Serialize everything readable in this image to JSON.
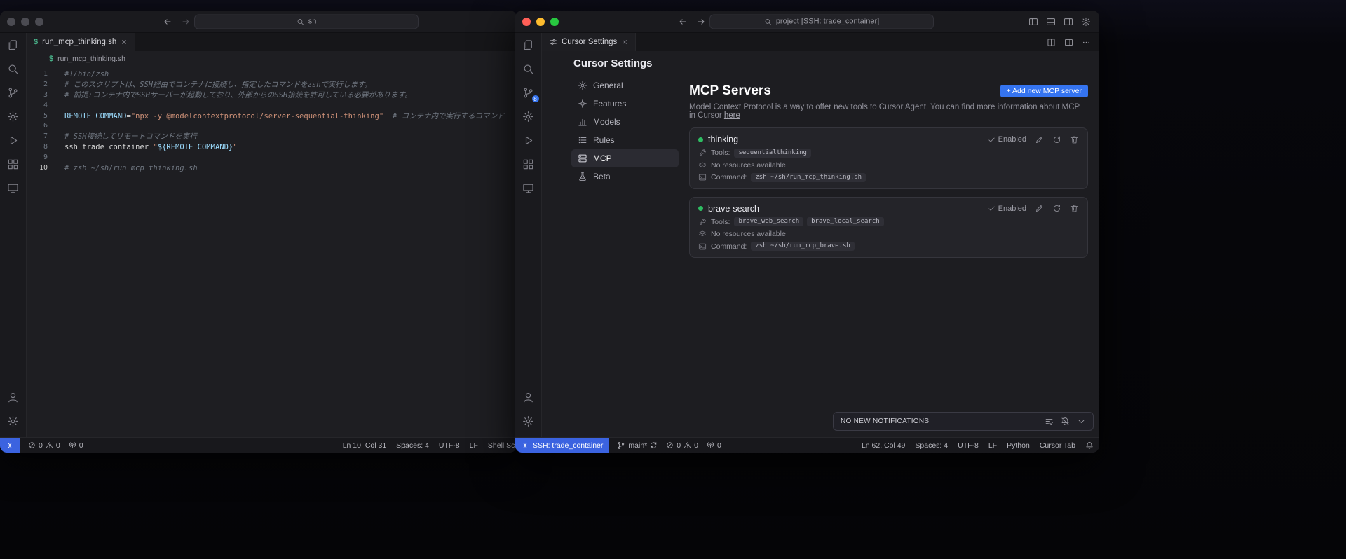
{
  "colors": {
    "accent_blue": "#3574f0",
    "remote_badge_blue": "#3b63e0",
    "enabled_green": "#2ebd62",
    "token_comment": "#6f7680",
    "token_string": "#ce9178",
    "token_variable": "#9cdcfe",
    "token_plain": "#d4d4d4"
  },
  "activity": {
    "top": [
      "explorer",
      "search",
      "source-control",
      "settings-gear",
      "run-debug",
      "extensions",
      "remote-explorer"
    ],
    "bottom": [
      "accounts",
      "manage"
    ]
  },
  "left": {
    "titlebar": {
      "search": "sh"
    },
    "tab": {
      "icon": "$",
      "label": "run_mcp_thinking.sh"
    },
    "breadcrumb": {
      "file": "run_mcp_thinking.sh"
    },
    "editor": {
      "active_line": "10",
      "lines": [
        {
          "num": "1",
          "segs": [
            {
              "s": "comment",
              "t": "#!/bin/zsh"
            }
          ]
        },
        {
          "num": "2",
          "segs": [
            {
              "s": "comment",
              "t": "# このスクリプトは、SSH経由でコンテナに接続し、指定したコマンドをzshで実行します。"
            }
          ]
        },
        {
          "num": "3",
          "segs": [
            {
              "s": "comment",
              "t": "# 前提:コンテナ内でSSHサーバーが起動しており、外部からのSSH接続を許可している必要があります。"
            }
          ]
        },
        {
          "num": "4",
          "segs": []
        },
        {
          "num": "5",
          "segs": [
            {
              "s": "var",
              "t": "REMOTE_COMMAND"
            },
            {
              "s": "plain",
              "t": "="
            },
            {
              "s": "string",
              "t": "\"npx -y @modelcontextprotocol/server-sequential-thinking\""
            },
            {
              "s": "plain",
              "t": "  "
            },
            {
              "s": "comment",
              "t": "# コンテナ内で実行するコマンド"
            }
          ]
        },
        {
          "num": "6",
          "segs": []
        },
        {
          "num": "7",
          "segs": [
            {
              "s": "comment",
              "t": "# SSH接続してリモートコマンドを実行"
            }
          ]
        },
        {
          "num": "8",
          "segs": [
            {
              "s": "plain",
              "t": "ssh trade_container "
            },
            {
              "s": "string",
              "t": "\""
            },
            {
              "s": "var",
              "t": "${REMOTE_COMMAND}"
            },
            {
              "s": "string",
              "t": "\""
            }
          ]
        },
        {
          "num": "9",
          "segs": []
        },
        {
          "num": "10",
          "segs": [
            {
              "s": "comment",
              "t": "# zsh ~/sh/run_mcp_thinking.sh"
            }
          ]
        }
      ]
    },
    "status": {
      "errors": "0",
      "warnings": "0",
      "ports": "0",
      "line_col": "Ln 10, Col 31",
      "spaces": "Spaces: 4",
      "encoding": "UTF-8",
      "eol": "LF",
      "language": "Shell Script"
    }
  },
  "right": {
    "titlebar": {
      "search": "project [SSH: trade_container]"
    },
    "tab": {
      "label": "Cursor Settings"
    },
    "activity_badge": "8",
    "settings": {
      "title": "Cursor Settings",
      "nav": [
        {
          "label": "General",
          "icon": "gear"
        },
        {
          "label": "Features",
          "icon": "spark"
        },
        {
          "label": "Models",
          "icon": "chart"
        },
        {
          "label": "Rules",
          "icon": "list"
        },
        {
          "label": "MCP",
          "icon": "server",
          "active": true
        },
        {
          "label": "Beta",
          "icon": "flask"
        }
      ],
      "mcp": {
        "heading": "MCP Servers",
        "add_button": "+ Add new MCP server",
        "description": "Model Context Protocol is a way to offer new tools to Cursor Agent. You can find more information about MCP in Cursor ",
        "description_link": "here",
        "servers": [
          {
            "name": "thinking",
            "enabled_label": "Enabled",
            "tools_label": "Tools:",
            "tools": [
              "sequentialthinking"
            ],
            "resources": "No resources available",
            "command_label": "Command:",
            "command": "zsh ~/sh/run_mcp_thinking.sh"
          },
          {
            "name": "brave-search",
            "enabled_label": "Enabled",
            "tools_label": "Tools:",
            "tools": [
              "brave_web_search",
              "brave_local_search"
            ],
            "resources": "No resources available",
            "command_label": "Command:",
            "command": "zsh ~/sh/run_mcp_brave.sh"
          }
        ]
      }
    },
    "notifications": {
      "text": "NO NEW NOTIFICATIONS"
    },
    "status": {
      "remote": "SSH: trade_container",
      "branch": "main*",
      "errors": "0",
      "warnings": "0",
      "ports": "0",
      "line_col": "Ln 62, Col 49",
      "spaces": "Spaces: 4",
      "encoding": "UTF-8",
      "eol": "LF",
      "language": "Python",
      "cursor_tab": "Cursor Tab"
    }
  }
}
